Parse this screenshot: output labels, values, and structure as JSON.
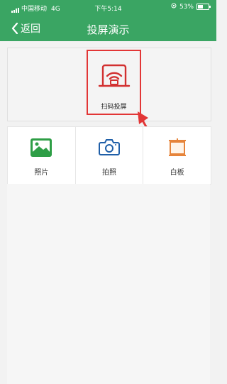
{
  "status_bar": {
    "carrier": "中国移动",
    "network": "4G",
    "time": "下午5:14",
    "battery_percent": "53%",
    "battery_level": 0.53
  },
  "nav": {
    "back_label": "返回",
    "title": "投屏演示"
  },
  "scan": {
    "label": "扫码投屏",
    "icon": "screen-cast-icon"
  },
  "features": [
    {
      "label": "照片",
      "icon": "image-icon"
    },
    {
      "label": "拍照",
      "icon": "camera-icon"
    },
    {
      "label": "白板",
      "icon": "whiteboard-icon"
    }
  ],
  "colors": {
    "header": "#3aa563",
    "highlight": "#e23636",
    "photo_icon": "#2e9e46",
    "camera_icon": "#1f5fa8",
    "whiteboard_icon": "#e6843a"
  }
}
